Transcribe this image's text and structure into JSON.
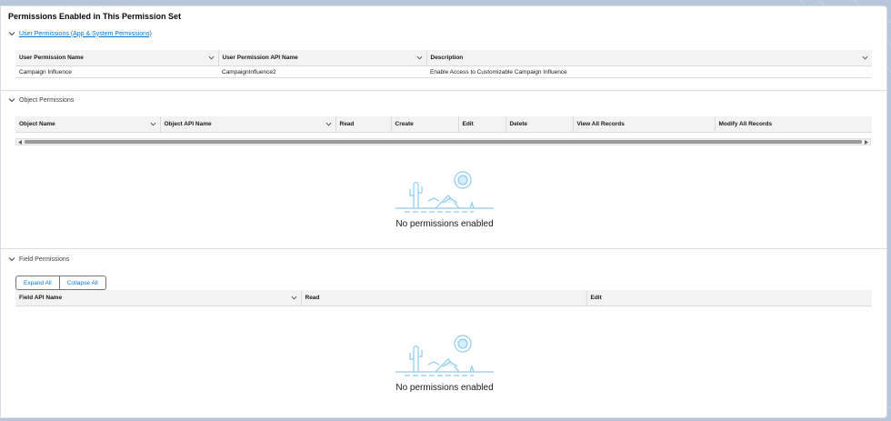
{
  "card": {
    "title": "Permissions Enabled in This Permission Set"
  },
  "user_permissions": {
    "section_label": "User Permissions (App & System Permissions)",
    "columns": [
      "User Permission Name",
      "User Permission API Name",
      "Description"
    ],
    "rows": [
      [
        "Campaign Influence",
        "CampaignInfluence2",
        "Enable Access to Customizable Campaign Influence"
      ]
    ]
  },
  "object_permissions": {
    "section_label": "Object Permissions",
    "columns": [
      "Object Name",
      "Object API Name",
      "Read",
      "Create",
      "Edit",
      "Delete",
      "View All Records",
      "Modify All Records"
    ],
    "empty_message": "No permissions enabled"
  },
  "field_permissions": {
    "section_label": "Field Permissions",
    "expand_all": "Expand All",
    "collapse_all": "Collapse All",
    "columns": [
      "Field API Name",
      "Read",
      "Edit"
    ],
    "empty_message": "No permissions enabled"
  },
  "colors": {
    "accent": "#0176d3",
    "header_bg": "#f3f3f3",
    "illustration": "#8ccbef"
  },
  "icons": {
    "section_toggle": "chevron-down-icon",
    "column_menu": "caret-down-icon",
    "empty_state": "desert-illustration"
  }
}
